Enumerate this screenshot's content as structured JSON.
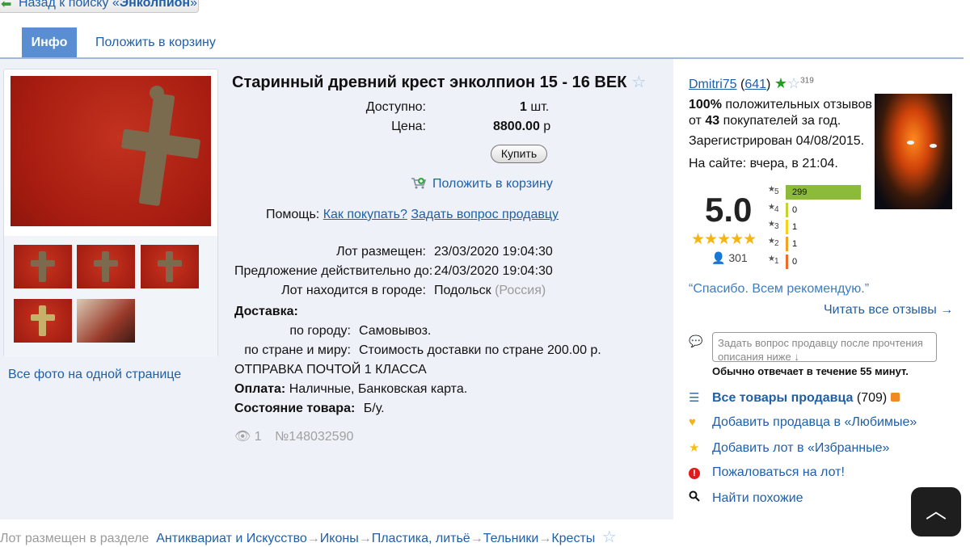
{
  "nav": {
    "back_prefix": "Назад к поиску «",
    "back_query": "Энколпион",
    "back_suffix": "»"
  },
  "tabs": {
    "info": "Инфо",
    "cart": "Положить в корзину"
  },
  "lot": {
    "title": "Старинный древний крест энколпион 15 - 16 ВЕК",
    "available_label": "Доступно:",
    "available_value": "1",
    "available_unit": "шт.",
    "price_label": "Цена:",
    "price_value": "8800.00",
    "price_unit": "р",
    "buy_label": "Купить",
    "add_to_cart": "Положить в корзину",
    "help_label": "Помощь:",
    "help_how": "Как покупать?",
    "help_ask": "Задать вопрос продавцу",
    "placed_label": "Лот размещен:",
    "placed_value": "23/03/2020 19:04:30",
    "valid_label": "Предложение действительно до:",
    "valid_value": "24/03/2020 19:04:30",
    "city_label": "Лот находится в городе:",
    "city_value": "Подольск",
    "country_value": "(Россия)",
    "delivery_label": "Доставка:",
    "by_city_label": "по городу:",
    "by_city_value": "Самовывоз.",
    "by_country_label": "по стране и миру:",
    "by_country_value": "Стоимость доставки по стране 200.00 р.",
    "shipping_note": "ОТПРАВКА ПОЧТОЙ 1 КЛАССА",
    "payment_label": "Оплата:",
    "payment_value": "Наличные, Банковская карта.",
    "condition_label": "Состояние товара:",
    "condition_value": "Б/у.",
    "views": "1",
    "lot_number": "№148032590"
  },
  "gallery": {
    "all_photos": "Все фото на одной странице",
    "thumb_count": 5
  },
  "seller": {
    "name": "Dmitri75",
    "open_paren": "(",
    "rating_count": "641",
    "close_paren": ")",
    "sup": "319",
    "positive_pct": "100%",
    "positive_text": "положительных отзывов",
    "from_text": "от",
    "buyers": "43",
    "buyers_text": "покупателей за год.",
    "registered": "Зарегистрирован 04/08/2015.",
    "online": "На сайте: вчера, в 21:04.",
    "score": "5.0",
    "reviews_count": "301",
    "bars": [
      {
        "stars": "5",
        "value": "299",
        "color": "#8cbb3a",
        "fraction": 0.997
      },
      {
        "stars": "4",
        "value": "0",
        "color": "#c3d430",
        "fraction": 0
      },
      {
        "stars": "3",
        "value": "1",
        "color": "#f2d21c",
        "fraction": 0.003
      },
      {
        "stars": "2",
        "value": "1",
        "color": "#f3a41e",
        "fraction": 0.003
      },
      {
        "stars": "1",
        "value": "0",
        "color": "#ee6a2a",
        "fraction": 0
      }
    ],
    "quote": "“Спасибо. Всем рекомендую.”",
    "read_all": "Читать все отзывы →",
    "ask_placeholder": "Задать вопрос продавцу после прочтения описания ниже ↓",
    "reply_time": "Обычно отвечает в течение 55 минут."
  },
  "actions": {
    "all_items": "Все товары продавца",
    "all_items_count": "(709)",
    "add_fav_seller": "Добавить продавца в «Любимые»",
    "add_fav_lot": "Добавить лот в «Избранные»",
    "complain": "Пожаловаться на лот!",
    "find_similar": "Найти похожие"
  },
  "breadcrumb": {
    "prefix": "Лот размещен в разделе",
    "items": [
      "Антиквариат и Искусство",
      "Иконы",
      "Пластика, литьё",
      "Тельники",
      "Кресты"
    ],
    "sep": "→"
  }
}
